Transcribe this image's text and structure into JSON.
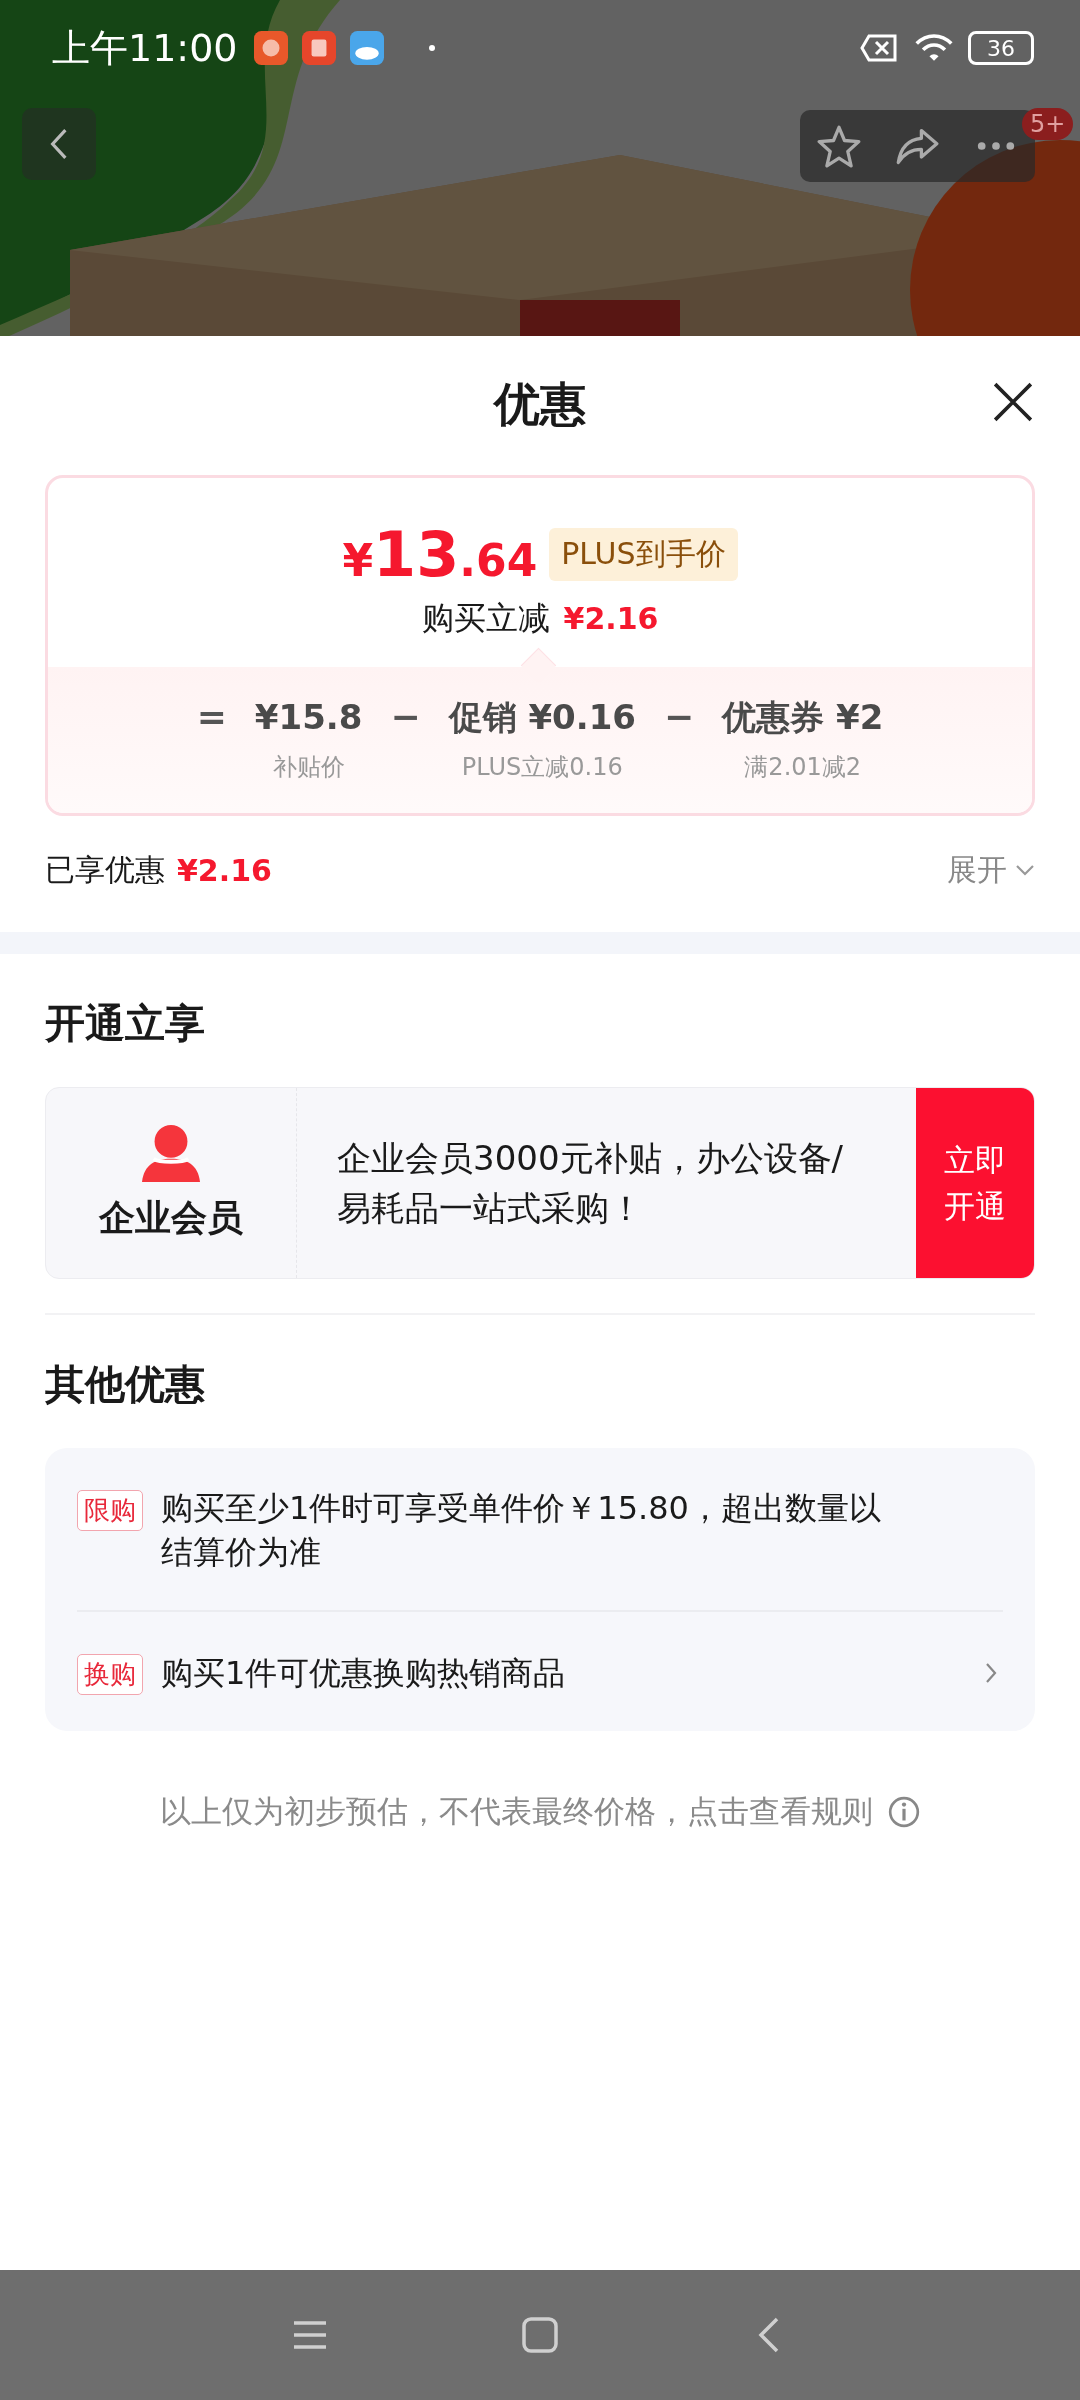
{
  "status_bar": {
    "time": "上午11:00",
    "battery": "36"
  },
  "top_actions": {
    "badge": "5+"
  },
  "sheet": {
    "title": "优惠"
  },
  "price_card": {
    "currency": "¥",
    "integer": "13",
    "decimal": ".64",
    "tag": "PLUS到手价",
    "reduce_label": "购买立减",
    "reduce_amount": "¥2.16",
    "breakdown": [
      {
        "op": "=",
        "amount": "¥15.8",
        "note": "补贴价"
      },
      {
        "op": "−",
        "amount": "促销 ¥0.16",
        "note": "PLUS立减0.16"
      },
      {
        "op": "−",
        "amount": "优惠券 ¥2",
        "note": "满2.01减2"
      }
    ]
  },
  "enjoyed": {
    "label": "已享优惠",
    "amount": "¥2.16",
    "toggle": "展开",
    "expanded": false
  },
  "membership": {
    "heading": "开通立享",
    "name": "企业会员",
    "description": "企业会员3000元补贴，办公设备/易耗品一站式采购！",
    "button": "立即开通"
  },
  "other": {
    "heading": "其他优惠",
    "offers": [
      {
        "tag": "限购",
        "text": "购买至少1件时可享受单件价￥15.80，超出数量以结算价为准",
        "has_arrow": false
      },
      {
        "tag": "换购",
        "text": "购买1件可优惠换购热销商品",
        "has_arrow": true
      }
    ]
  },
  "footer": {
    "text": "以上仅为初步预估，不代表最终价格，点击查看规则"
  }
}
